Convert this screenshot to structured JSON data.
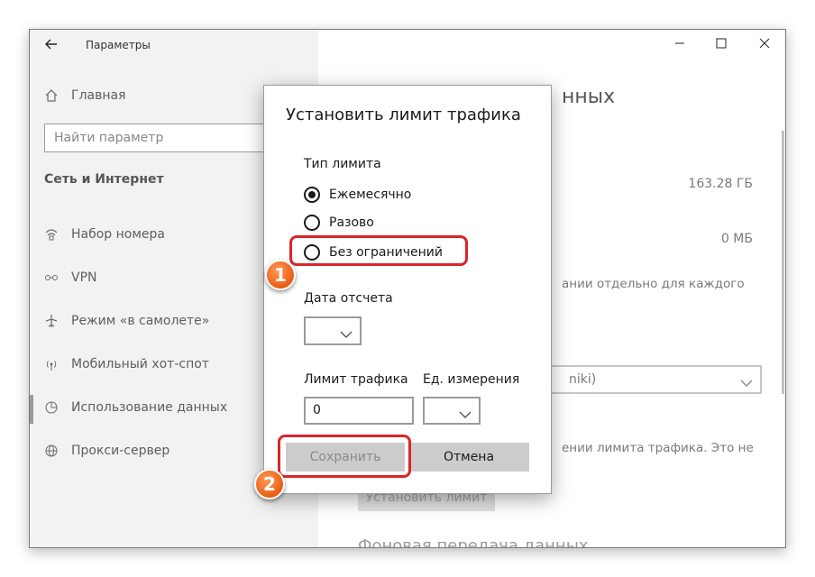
{
  "window": {
    "title": "Параметры"
  },
  "sidebar": {
    "home_label": "Главная",
    "search_placeholder": "Найти параметр",
    "section_title": "Сеть и Интернет",
    "items": [
      {
        "label": "Набор номера",
        "icon": "dialup-icon"
      },
      {
        "label": "VPN",
        "icon": "vpn-icon"
      },
      {
        "label": "Режим «в самолете»",
        "icon": "airplane-icon"
      },
      {
        "label": "Мобильный хот-спот",
        "icon": "hotspot-icon"
      },
      {
        "label": "Использование данных",
        "icon": "data-usage-icon"
      },
      {
        "label": "Прокси-сервер",
        "icon": "globe-icon"
      }
    ]
  },
  "main": {
    "heading_fragment": "нных",
    "usage_value_1": "163.28 ГБ",
    "usage_value_2": "0 МБ",
    "note_fragment": "ании отдельно для каждого",
    "network_dropdown_value": "niki)",
    "limit_note_fragment": "ении лимита трафика. Это не",
    "set_limit_button": "Установить лимит",
    "background_heading": "Фоновая передача данных"
  },
  "dialog": {
    "title": "Установить лимит трафика",
    "limit_type_label": "Тип лимита",
    "options": [
      {
        "label": "Ежемесячно",
        "selected": true
      },
      {
        "label": "Разово",
        "selected": false
      },
      {
        "label": "Без ограничений",
        "selected": false
      }
    ],
    "reset_date_label": "Дата отсчета",
    "traffic_limit_label": "Лимит трафика",
    "unit_label": "Ед. измерения",
    "traffic_limit_value": "0",
    "save_button": "Сохранить",
    "cancel_button": "Отмена"
  },
  "annotations": {
    "step1": "1",
    "step2": "2",
    "highlight_color": "#d9262b",
    "badge_color": "#e85d14"
  }
}
